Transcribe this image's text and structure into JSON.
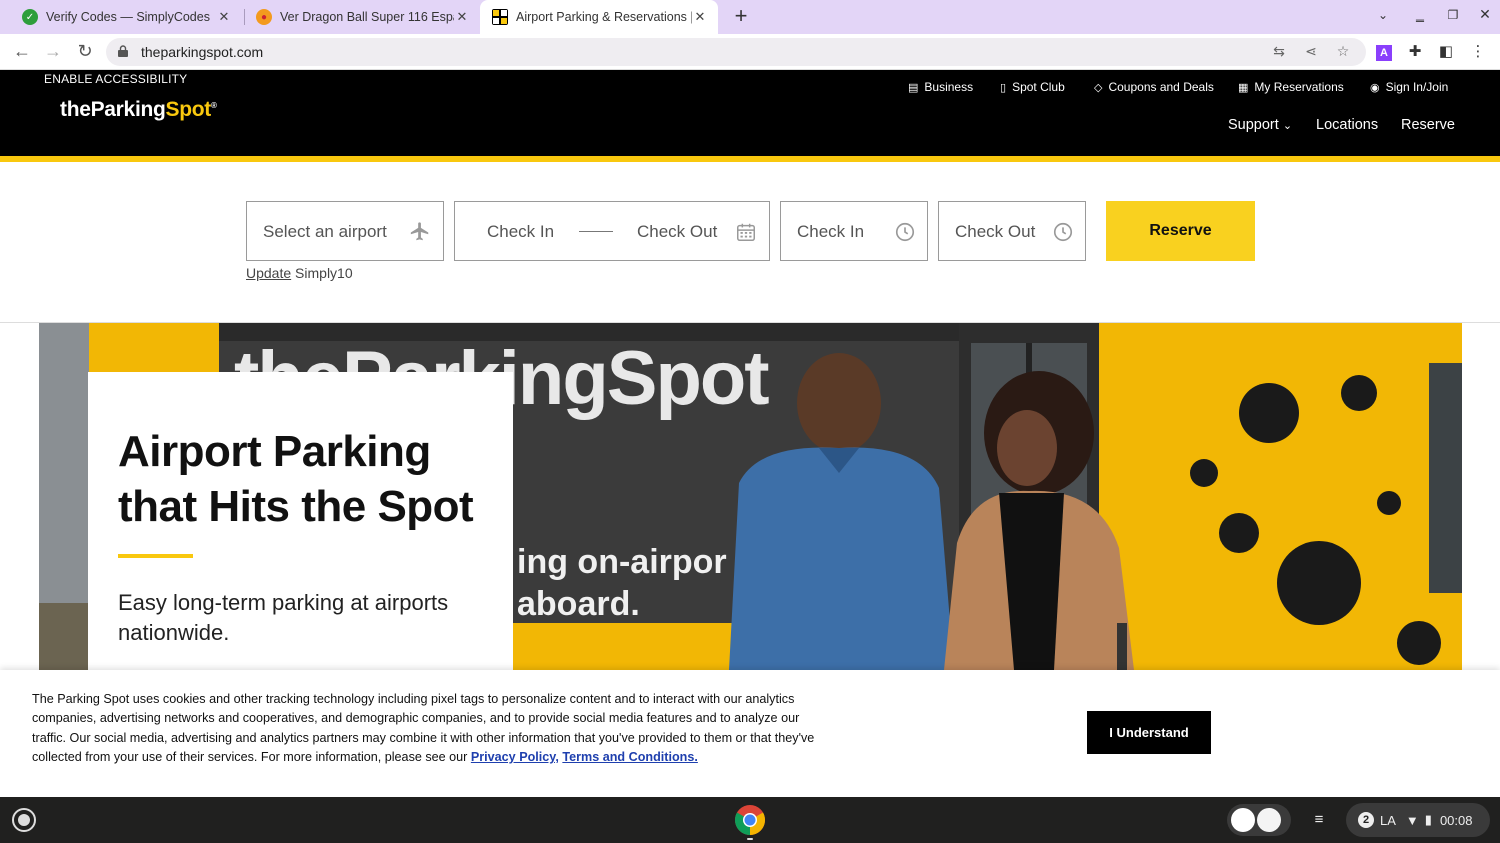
{
  "browser": {
    "tabs": [
      {
        "title": "Verify Codes — SimplyCodes",
        "favicon": "simplycodes-check-icon"
      },
      {
        "title": "Ver Dragon Ball Super 116 Espa",
        "favicon": "dragonball-icon"
      },
      {
        "title": "Airport Parking & Reservations |",
        "favicon": "parkingspot-icon"
      }
    ],
    "url": "theparkingspot.com"
  },
  "header": {
    "accessibility": "ENABLE ACCESSIBILITY",
    "logo": {
      "the": "theParking",
      "spot": "Spot",
      "mark": "®"
    },
    "utility_links": [
      "Business",
      "Spot Club",
      "Coupons and Deals",
      "My Reservations",
      "Sign In/Join"
    ],
    "main_links": [
      "Support",
      "Locations",
      "Reserve"
    ]
  },
  "search": {
    "airport_placeholder": "Select an airport",
    "check_in": "Check In",
    "check_out": "Check Out",
    "time_in": "Check In",
    "time_out": "Check Out",
    "reserve": "Reserve",
    "promo_link": "Update",
    "promo_code": "Simply10"
  },
  "hero": {
    "title": "Airport Parking that Hits the Spot",
    "subtitle": "Easy long-term parking at airports nationwide.",
    "photo_text_logo": "theParkingSpot",
    "photo_text_1": "ing on-airpor",
    "photo_text_2": "aboard."
  },
  "cookie": {
    "text": "The Parking Spot uses cookies and other tracking technology including pixel tags to personalize content and to interact with our analytics companies, advertising networks and cooperatives, and demographic companies, and to provide social media features and to analyze our traffic. Our social media, advertising and analytics partners may combine it with other information that you've provided to them or that they've collected from your use of their services. For more information, please see our ",
    "privacy_link": "Privacy Policy,",
    "terms_link": "Terms and Conditions.",
    "button": "I Understand"
  },
  "shelf": {
    "notifications": "2",
    "locale": "LA",
    "time": "00:08"
  },
  "colors": {
    "brand_yellow": "#f9c80e",
    "header_black": "#000000",
    "tabstrip": "#e3d5f7",
    "link_blue": "#1e3fae"
  }
}
